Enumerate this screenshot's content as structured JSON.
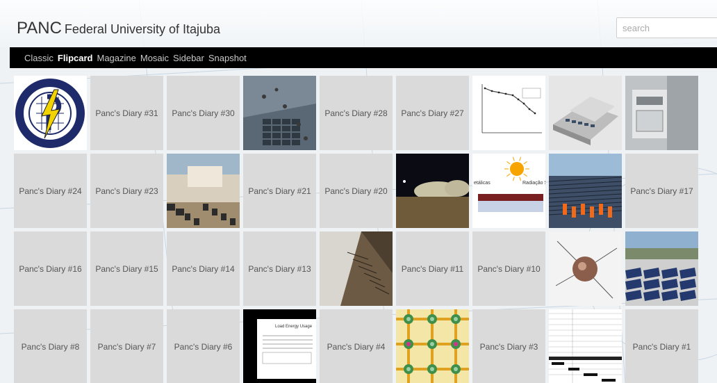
{
  "brand": {
    "short": "PANC",
    "full": "Federal University of Itajuba"
  },
  "search": {
    "placeholder": "search"
  },
  "nav": [
    "Classic",
    "Flipcard",
    "Magazine",
    "Mosaic",
    "Sidebar",
    "Snapshot"
  ],
  "nav_active": "Flipcard",
  "tiles": [
    {
      "type": "image",
      "name": "panc-logo-image"
    },
    {
      "type": "label",
      "label": "Panc's Diary #31"
    },
    {
      "type": "label",
      "label": "Panc's Diary #30"
    },
    {
      "type": "image",
      "name": "solar-floor-photo"
    },
    {
      "type": "label",
      "label": "Panc's Diary #28"
    },
    {
      "type": "label",
      "label": "Panc's Diary #27"
    },
    {
      "type": "image",
      "name": "line-chart-thumbnail"
    },
    {
      "type": "image",
      "name": "building-render-photo"
    },
    {
      "type": "image",
      "name": "kitchen-equipment-photo"
    },
    {
      "type": "label",
      "label": "Panc's Diary #24"
    },
    {
      "type": "label",
      "label": "Panc's Diary #23"
    },
    {
      "type": "image",
      "name": "crowd-plaza-photo"
    },
    {
      "type": "label",
      "label": "Panc's Diary #21"
    },
    {
      "type": "label",
      "label": "Panc's Diary #20"
    },
    {
      "type": "image",
      "name": "night-domes-photo"
    },
    {
      "type": "image",
      "name": "solar-cell-diagram"
    },
    {
      "type": "image",
      "name": "solar-farm-workers-photo"
    },
    {
      "type": "label",
      "label": "Panc's Diary #17"
    },
    {
      "type": "label",
      "label": "Panc's Diary #16"
    },
    {
      "type": "label",
      "label": "Panc's Diary #15"
    },
    {
      "type": "label",
      "label": "Panc's Diary #14"
    },
    {
      "type": "label",
      "label": "Panc's Diary #13"
    },
    {
      "type": "image",
      "name": "mountain-aerial-photo"
    },
    {
      "type": "label",
      "label": "Panc's Diary #11"
    },
    {
      "type": "label",
      "label": "Panc's Diary #10"
    },
    {
      "type": "image",
      "name": "satellite-photo"
    },
    {
      "type": "image",
      "name": "rooftop-panels-photo"
    },
    {
      "type": "label",
      "label": "Panc's Diary #8"
    },
    {
      "type": "label",
      "label": "Panc's Diary #7"
    },
    {
      "type": "label",
      "label": "Panc's Diary #6"
    },
    {
      "type": "image",
      "name": "load-energy-slide"
    },
    {
      "type": "label",
      "label": "Panc's Diary #4"
    },
    {
      "type": "image",
      "name": "circuit-pattern-image"
    },
    {
      "type": "label",
      "label": "Panc's Diary #3"
    },
    {
      "type": "image",
      "name": "spreadsheet-image"
    },
    {
      "type": "label",
      "label": "Panc's Diary #1"
    }
  ],
  "slide": {
    "title": "Load Energy Usage"
  },
  "diagram": {
    "left": "etálicas",
    "right": "Radiação So"
  },
  "logo_text": "Photovoltaic Application in Needy Communities"
}
